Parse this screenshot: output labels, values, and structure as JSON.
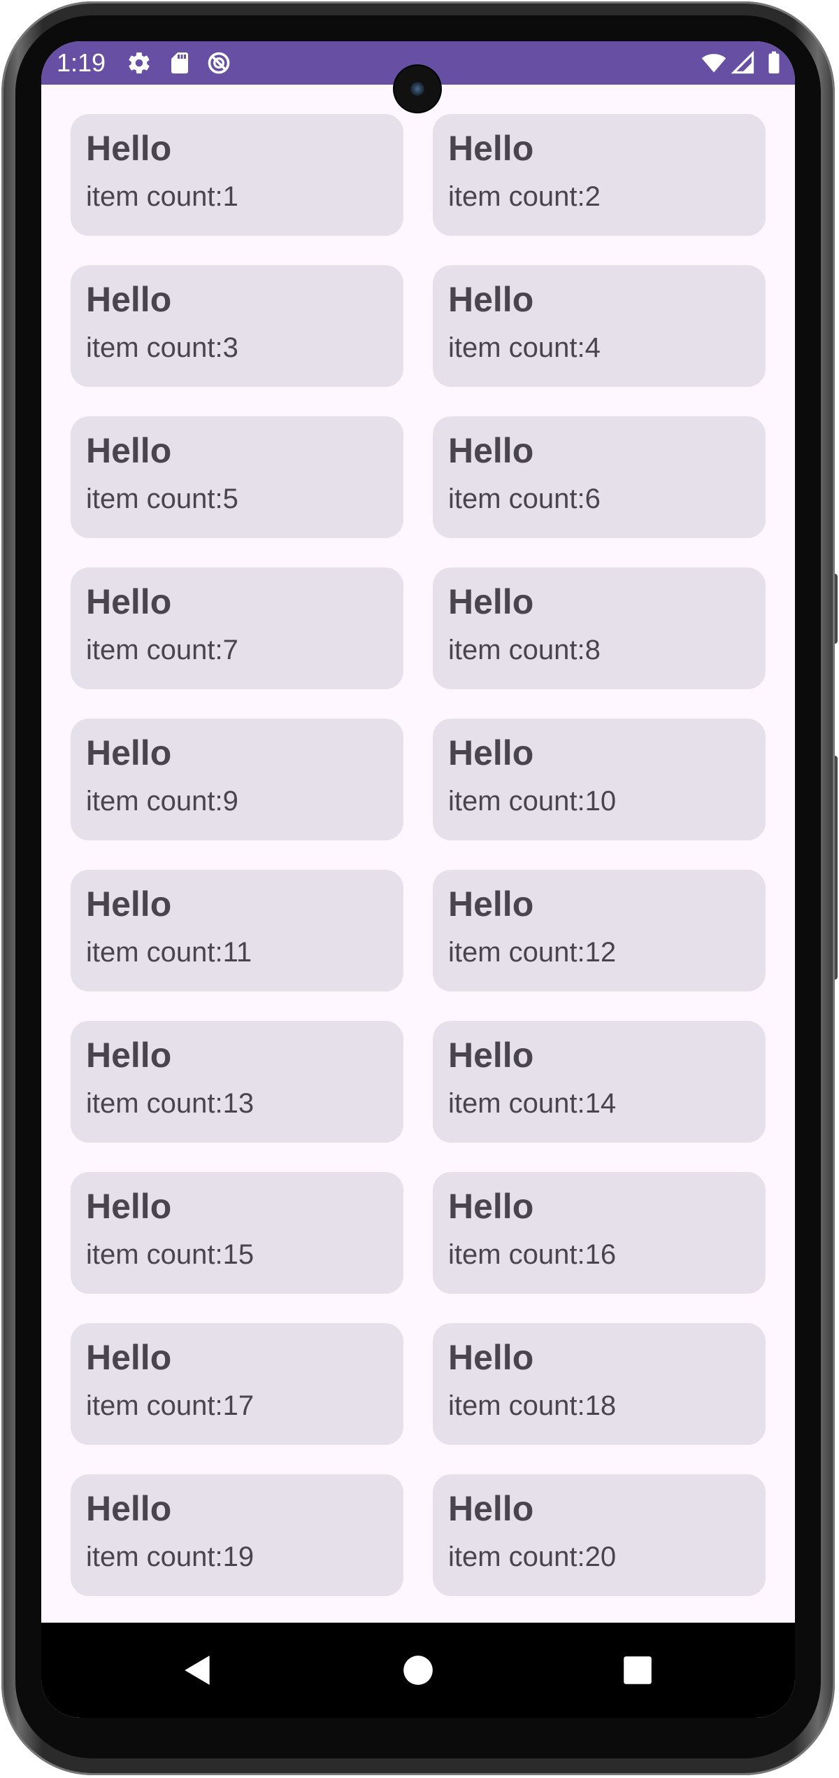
{
  "status_bar": {
    "time": "1:19",
    "background": "#6750a4",
    "left_icons": [
      "settings-icon",
      "sd-card-icon",
      "do-not-disturb-icon"
    ],
    "right_icons": [
      "wifi-icon",
      "signal-icon",
      "battery-icon"
    ]
  },
  "grid": {
    "card_color": "#e6e0ea",
    "items": [
      {
        "title": "Hello",
        "count": "item count:1"
      },
      {
        "title": "Hello",
        "count": "item count:2"
      },
      {
        "title": "Hello",
        "count": "item count:3"
      },
      {
        "title": "Hello",
        "count": "item count:4"
      },
      {
        "title": "Hello",
        "count": "item count:5"
      },
      {
        "title": "Hello",
        "count": "item count:6"
      },
      {
        "title": "Hello",
        "count": "item count:7"
      },
      {
        "title": "Hello",
        "count": "item count:8"
      },
      {
        "title": "Hello",
        "count": "item count:9"
      },
      {
        "title": "Hello",
        "count": "item count:10"
      },
      {
        "title": "Hello",
        "count": "item count:11"
      },
      {
        "title": "Hello",
        "count": "item count:12"
      },
      {
        "title": "Hello",
        "count": "item count:13"
      },
      {
        "title": "Hello",
        "count": "item count:14"
      },
      {
        "title": "Hello",
        "count": "item count:15"
      },
      {
        "title": "Hello",
        "count": "item count:16"
      },
      {
        "title": "Hello",
        "count": "item count:17"
      },
      {
        "title": "Hello",
        "count": "item count:18"
      },
      {
        "title": "Hello",
        "count": "item count:19"
      },
      {
        "title": "Hello",
        "count": "item count:20"
      },
      {
        "title": "",
        "count": ""
      },
      {
        "title": "",
        "count": ""
      }
    ]
  },
  "nav_bar": {
    "buttons": [
      "back-icon",
      "home-icon",
      "recents-icon"
    ]
  }
}
